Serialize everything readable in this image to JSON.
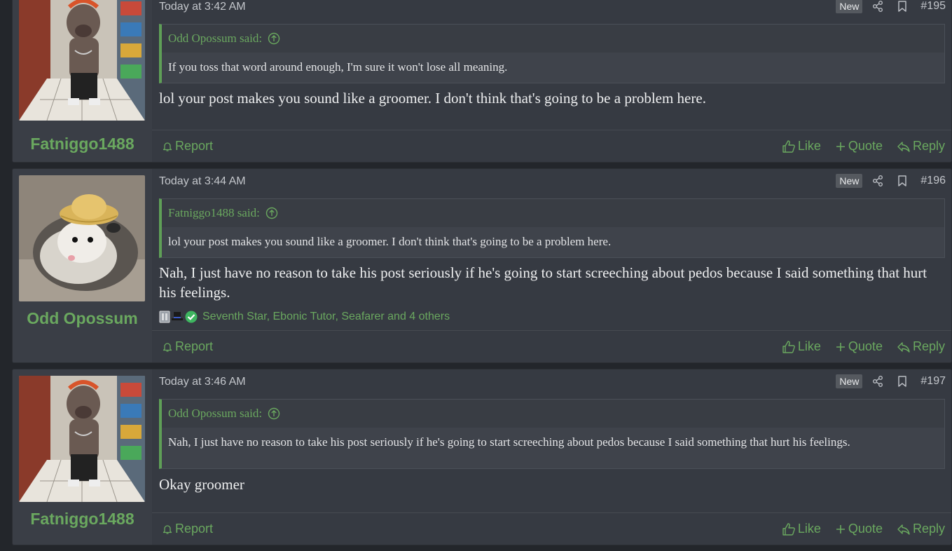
{
  "colors": {
    "accent": "#6aa85f",
    "post_bg": "#363a42",
    "page_bg": "#23262b",
    "quote_bg": "#3f434b",
    "text": "#eeeff0"
  },
  "posts": [
    {
      "username": "Fatniggo1488",
      "avatar": "dog-in-store-avatar",
      "date": "Today at 3:42 AM",
      "badge": "New",
      "number": "#195",
      "quote_author": "Odd Opossum said:",
      "quote_text": "If you toss that word around enough, I'm sure it won't lose all meaning.",
      "message": "lol your post makes you sound like a groomer. I don't think that's going to be a problem here.",
      "report": "Report",
      "like": "Like",
      "quote": "Quote",
      "reply": "Reply"
    },
    {
      "username": "Odd Opossum",
      "avatar": "opossum-with-hat-avatar",
      "date": "Today at 3:44 AM",
      "badge": "New",
      "number": "#196",
      "quote_author": "Fatniggo1488 said:",
      "quote_text": "lol your post makes you sound like a groomer. I don't think that's going to be a problem here.",
      "message": "Nah, I just have no reason to take his post seriously if he's going to start screeching about pedos because I said something that hurt his feelings.",
      "reactions": "Seventh Star, Ebonic Tutor, Seafarer and 4 others",
      "report": "Report",
      "like": "Like",
      "quote": "Quote",
      "reply": "Reply"
    },
    {
      "username": "Fatniggo1488",
      "avatar": "dog-in-store-avatar",
      "date": "Today at 3:46 AM",
      "badge": "New",
      "number": "#197",
      "quote_author": "Odd Opossum said:",
      "quote_text": "Nah, I just have no reason to take his post seriously if he's going to start screeching about pedos because I said something that hurt his feelings.",
      "message": "Okay groomer",
      "report": "Report",
      "like": "Like",
      "quote": "Quote",
      "reply": "Reply"
    }
  ]
}
